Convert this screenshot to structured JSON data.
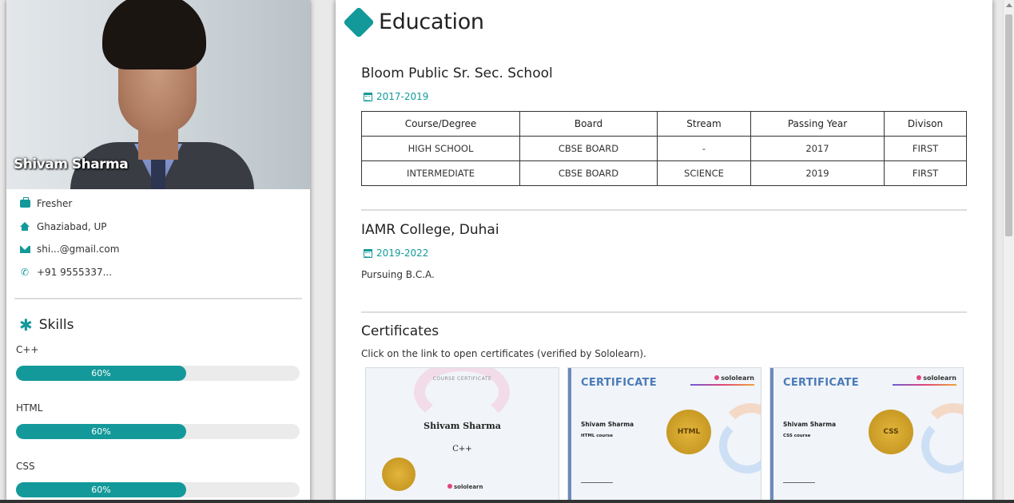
{
  "profile": {
    "name": "Shivam Sharma",
    "status": "Fresher",
    "location": "Ghaziabad, UP",
    "email": "shi...@gmail.com",
    "phone": "+91 9555337..."
  },
  "skills": {
    "title": "Skills",
    "items": [
      {
        "name": "C++",
        "percent_label": "60%",
        "level": 0.6
      },
      {
        "name": "HTML",
        "percent_label": "60%",
        "level": 0.6
      },
      {
        "name": "CSS",
        "percent_label": "60%",
        "level": 0.6
      }
    ]
  },
  "education": {
    "title": "Education",
    "school": {
      "name": "Bloom Public Sr. Sec. School",
      "dates": "2017-2019",
      "table": {
        "headers": [
          "Course/Degree",
          "Board",
          "Stream",
          "Passing Year",
          "Divison"
        ],
        "rows": [
          [
            "HIGH SCHOOL",
            "CBSE BOARD",
            "-",
            "2017",
            "FIRST"
          ],
          [
            "INTERMEDIATE",
            "CBSE BOARD",
            "SCIENCE",
            "2019",
            "FIRST"
          ]
        ]
      }
    },
    "college": {
      "name": "IAMR College, Duhai",
      "dates": "2019-2022",
      "description": "Pursuing B.C.A."
    }
  },
  "certificates": {
    "title": "Certificates",
    "description": "Click on the link to open certificates (verified by Sololearn).",
    "items": [
      {
        "kind": "COURSE CERTIFICATE",
        "holder": "Shivam Sharma",
        "course": "C++",
        "brand": "sololearn"
      },
      {
        "kind": "CERTIFICATE",
        "holder": "Shivam Sharma",
        "course": "HTML course",
        "seal": "HTML",
        "brand": "sololearn"
      },
      {
        "kind": "CERTIFICATE",
        "holder": "Shivam Sharma",
        "course": "CSS course",
        "seal": "CSS",
        "brand": "sololearn"
      }
    ]
  },
  "colors": {
    "accent": "#14999a",
    "bar_track": "#ebebeb"
  }
}
